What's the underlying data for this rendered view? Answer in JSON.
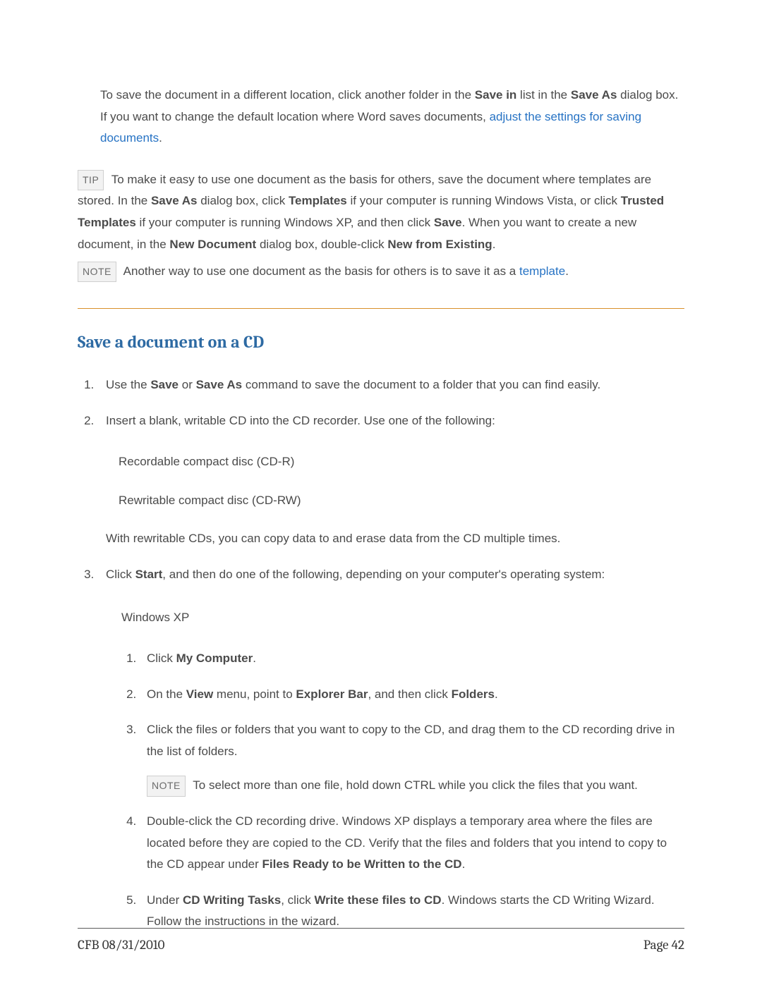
{
  "intro": {
    "pre": "To save the document in a different location, click another folder in the ",
    "b1": "Save in",
    "mid1": " list in the ",
    "b2": "Save As",
    "mid2": " dialog box. If you want to change the default location where Word saves documents, ",
    "link": "adjust the settings for saving documents",
    "post": "."
  },
  "tip": {
    "badge": "TIP",
    "t1": " To make it easy to use one document as the basis for others, save the document where templates are stored. In the ",
    "b1": "Save As",
    "t2": " dialog box, click ",
    "b2": "Templates",
    "t3": " if your computer is running Windows Vista, or click ",
    "b3": "Trusted Templates",
    "t4": " if your computer is running Windows XP, and then click ",
    "b4": "Save",
    "t5": ". When you want to create a new document, in the ",
    "b5": "New Document",
    "t6": " dialog box, double-click ",
    "b6": "New from Existing",
    "t7": "."
  },
  "note1": {
    "badge": "NOTE",
    "t1": " Another way to use one document as the basis for others is to save it as a ",
    "link": "template",
    "t2": "."
  },
  "heading": "Save a document on a CD",
  "steps": {
    "s1": {
      "t1": "Use the ",
      "b1": "Save",
      "t2": " or ",
      "b2": "Save As",
      "t3": " command to save the document to a folder that you can find easily."
    },
    "s2": {
      "t1": "Insert a blank, writable CD into the CD recorder. Use one of the following:",
      "cd1": "Recordable compact disc (CD-R)",
      "cd2": "Rewritable compact disc (CD-RW)",
      "note": "With rewritable CDs, you can copy data to and erase data from the CD multiple times."
    },
    "s3": {
      "t1": "Click ",
      "b1": "Start",
      "t2": ", and then do one of the following, depending on your computer's operating system:",
      "xp_label": "Windows XP",
      "xp": {
        "i1": {
          "t1": "Click ",
          "b1": "My Computer",
          "t2": "."
        },
        "i2": {
          "t1": "On the ",
          "b1": "View",
          "t2": " menu, point to ",
          "b2": "Explorer Bar",
          "t3": ", and then click ",
          "b3": "Folders",
          "t4": "."
        },
        "i3": {
          "t1": "Click the files or folders that you want to copy to the CD, and drag them to the CD recording drive in the list of folders.",
          "note_badge": "NOTE",
          "note": " To select more than one file, hold down CTRL while you click the files that you want."
        },
        "i4": {
          "t1": "Double-click the CD recording drive. Windows XP displays a temporary area where the files are located before they are copied to the CD. Verify that the files and folders that you intend to copy to the CD appear under ",
          "b1": "Files Ready to be Written to the CD",
          "t2": "."
        },
        "i5": {
          "t1": "Under ",
          "b1": "CD Writing Tasks",
          "t2": ", click ",
          "b2": "Write these files to CD",
          "t3": ". Windows starts the CD Writing Wizard. Follow the instructions in the wizard."
        }
      }
    }
  },
  "footer": {
    "left": "CFB 08/31/2010",
    "right": "Page 42"
  }
}
